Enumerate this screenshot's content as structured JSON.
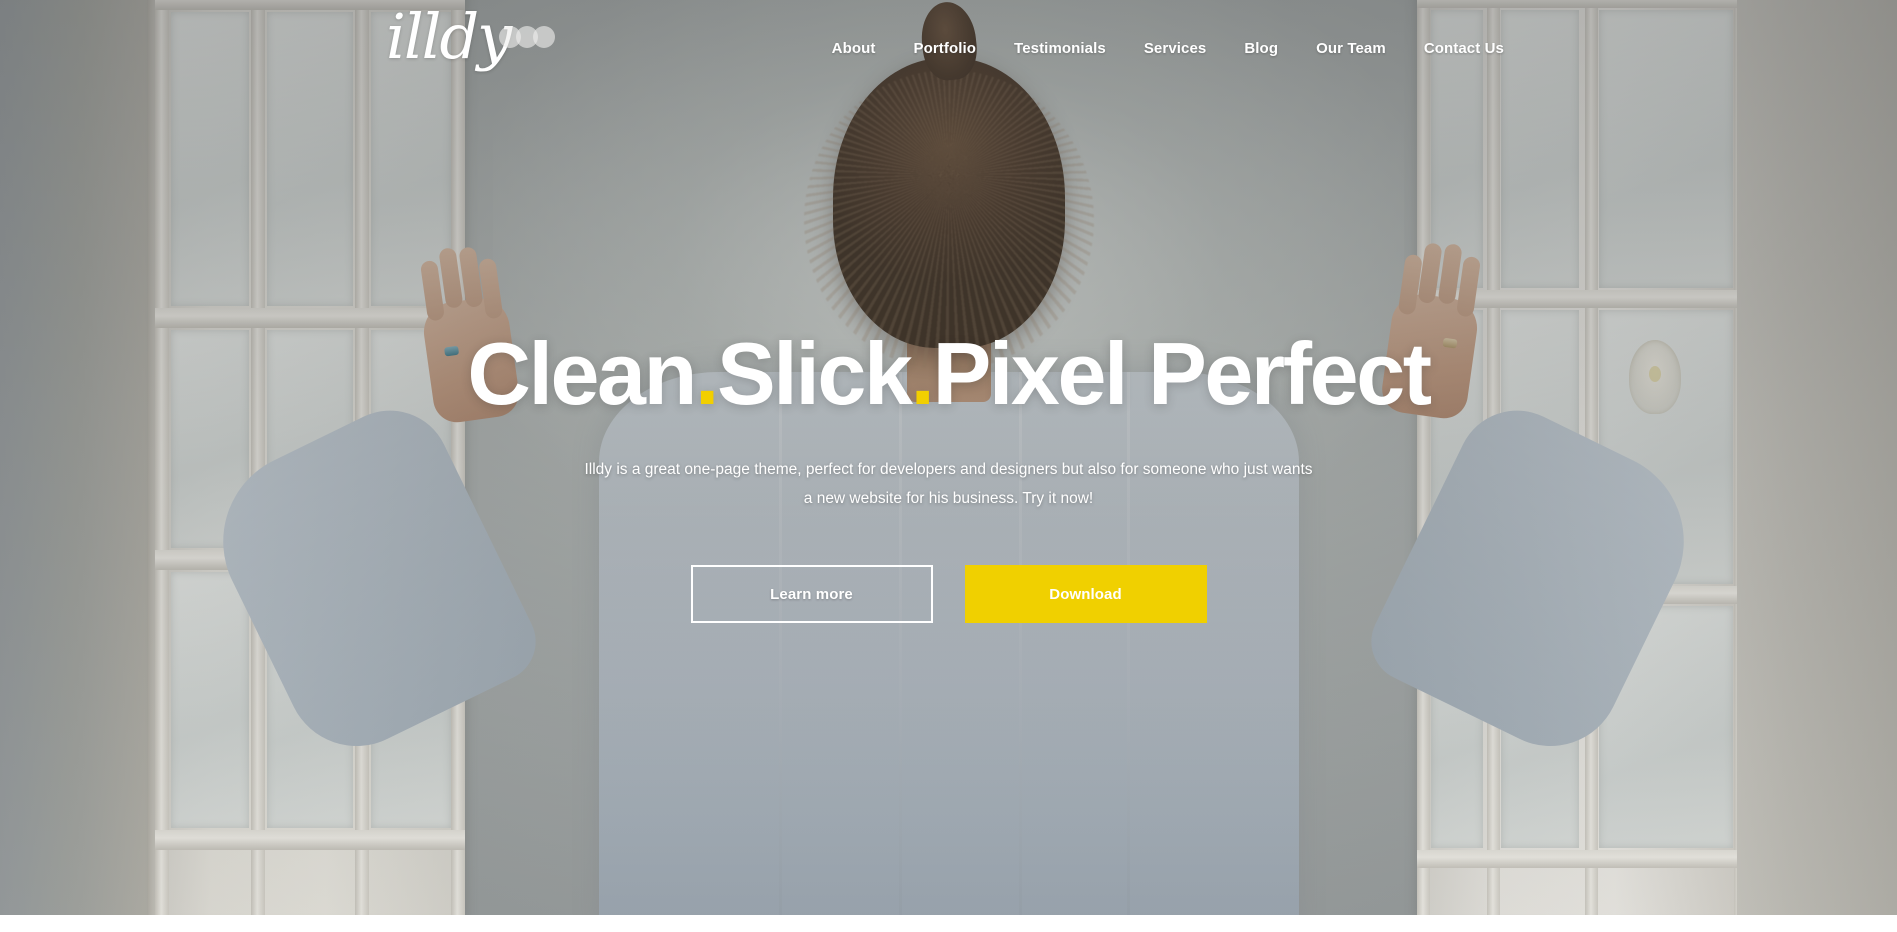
{
  "header": {
    "logo": {
      "text": "illdy",
      "dots_count": 3,
      "dot_color": "#eeeeec"
    },
    "nav": [
      {
        "label": "About"
      },
      {
        "label": "Portfolio"
      },
      {
        "label": "Testimonials"
      },
      {
        "label": "Services"
      },
      {
        "label": "Blog"
      },
      {
        "label": "Our Team"
      },
      {
        "label": "Contact Us"
      }
    ]
  },
  "hero": {
    "title_parts": [
      {
        "text": "Clean",
        "type": "word"
      },
      {
        "text": ".",
        "type": "dot"
      },
      {
        "text": "Slick",
        "type": "word"
      },
      {
        "text": ".",
        "type": "dot"
      },
      {
        "text": "Pixel Perfect",
        "type": "word"
      }
    ],
    "title_plain": "Clean.Slick.Pixel Perfect",
    "subtitle": "Illdy is a great one-page theme, perfect for developers and designers but also for someone who just wants a new website for his business. Try it now!",
    "buttons": {
      "secondary_label": "Learn more",
      "primary_label": "Download"
    },
    "background_description": "Woman seen from behind with hair in a bun, wearing a light blue shirt, pushing open white French doors"
  },
  "colors": {
    "accent_yellow": "#f0d000",
    "title_dot_yellow": "#f2cf00",
    "text_white": "#ffffff",
    "page_background": "#ffffff"
  }
}
